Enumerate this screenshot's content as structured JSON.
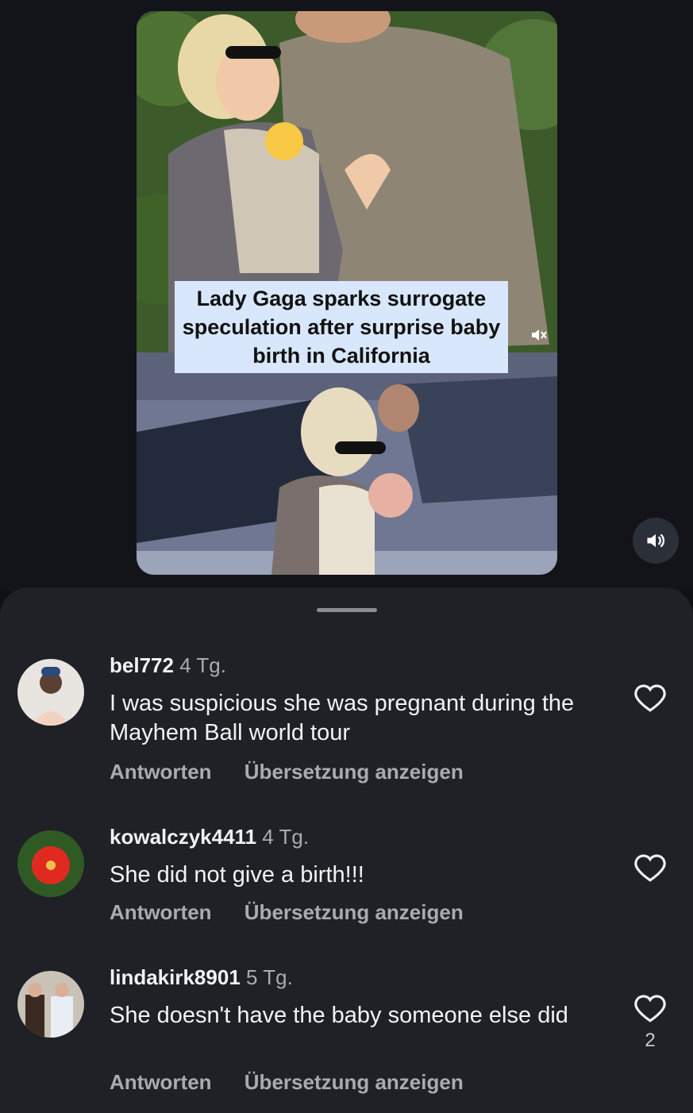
{
  "post": {
    "caption": "Lady Gaga sparks surrogate speculation after surprise baby birth in California",
    "icons": {
      "mute": "muted-speaker-icon",
      "volume": "speaker-icon"
    }
  },
  "comments": [
    {
      "username": "bel772",
      "time": "4 Tg.",
      "text": "I was suspicious she was pregnant during the Mayhem Ball world tour",
      "reply": "Antworten",
      "translate": "Übersetzung anzeigen",
      "likes": ""
    },
    {
      "username": "kowalczyk4411",
      "time": "4 Tg.",
      "text": "She did not give a birth!!!",
      "reply": "Antworten",
      "translate": "Übersetzung anzeigen",
      "likes": ""
    },
    {
      "username": "lindakirk8901",
      "time": "5 Tg.",
      "text": "She doesn't have the baby someone else did",
      "reply": "Antworten",
      "translate": "Übersetzung anzeigen",
      "likes": "2"
    }
  ]
}
